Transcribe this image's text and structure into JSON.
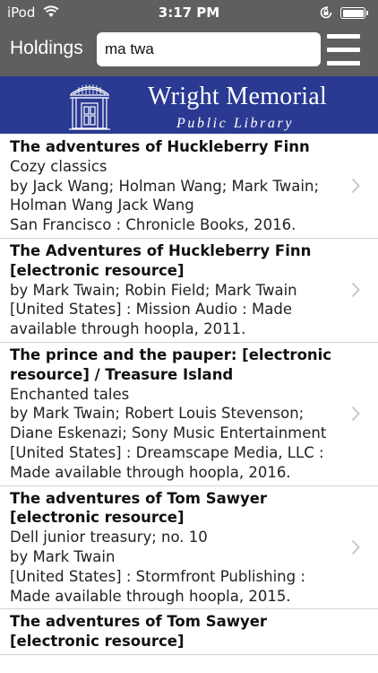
{
  "status_bar": {
    "carrier": "iPod",
    "time": "3:17 PM",
    "wifi_icon": "wifi-icon",
    "lock_icon": "rotation-lock-icon",
    "battery_icon": "battery-icon",
    "battery_level": 1.0
  },
  "nav": {
    "title": "Holdings",
    "search_value": "ma twa",
    "menu_icon": "hamburger-menu-icon"
  },
  "banner": {
    "name": "Wright Memorial",
    "subtitle": "Public Library",
    "logo_icon": "library-building-icon",
    "background_color": "#2a3a92"
  },
  "colors": {
    "header": "#5f5f5f",
    "divider": "#d4d4d4",
    "chevron": "#c7c7cc"
  },
  "results": [
    {
      "title": "The adventures of Huckleberry Finn",
      "series": "Cozy classics",
      "authors": "by Jack Wang; Holman Wang; Mark Twain; Holman Wang Jack Wang",
      "publisher": "San Francisco : Chronicle Books, 2016."
    },
    {
      "title": "The Adventures of Huckleberry Finn [electronic resource]",
      "series": "",
      "authors": "by Mark Twain; Robin Field; Mark Twain",
      "publisher": "[United States] : Mission Audio : Made available through hoopla, 2011."
    },
    {
      "title": "The prince and the pauper: [electronic resource] / Treasure Island",
      "series": "Enchanted tales",
      "authors": "by Mark Twain; Robert Louis Stevenson; Diane Eskenazi; Sony Music Entertainment",
      "publisher": "[United States] : Dreamscape Media, LLC : Made available through hoopla, 2016."
    },
    {
      "title": "The adventures of Tom Sawyer [electronic resource]",
      "series": "Dell junior treasury; no. 10",
      "authors": "by Mark Twain",
      "publisher": "[United States] : Stormfront Publishing : Made available through hoopla, 2015."
    },
    {
      "title": "The adventures of Tom Sawyer [electronic resource]",
      "series": "",
      "authors": "",
      "publisher": ""
    }
  ]
}
